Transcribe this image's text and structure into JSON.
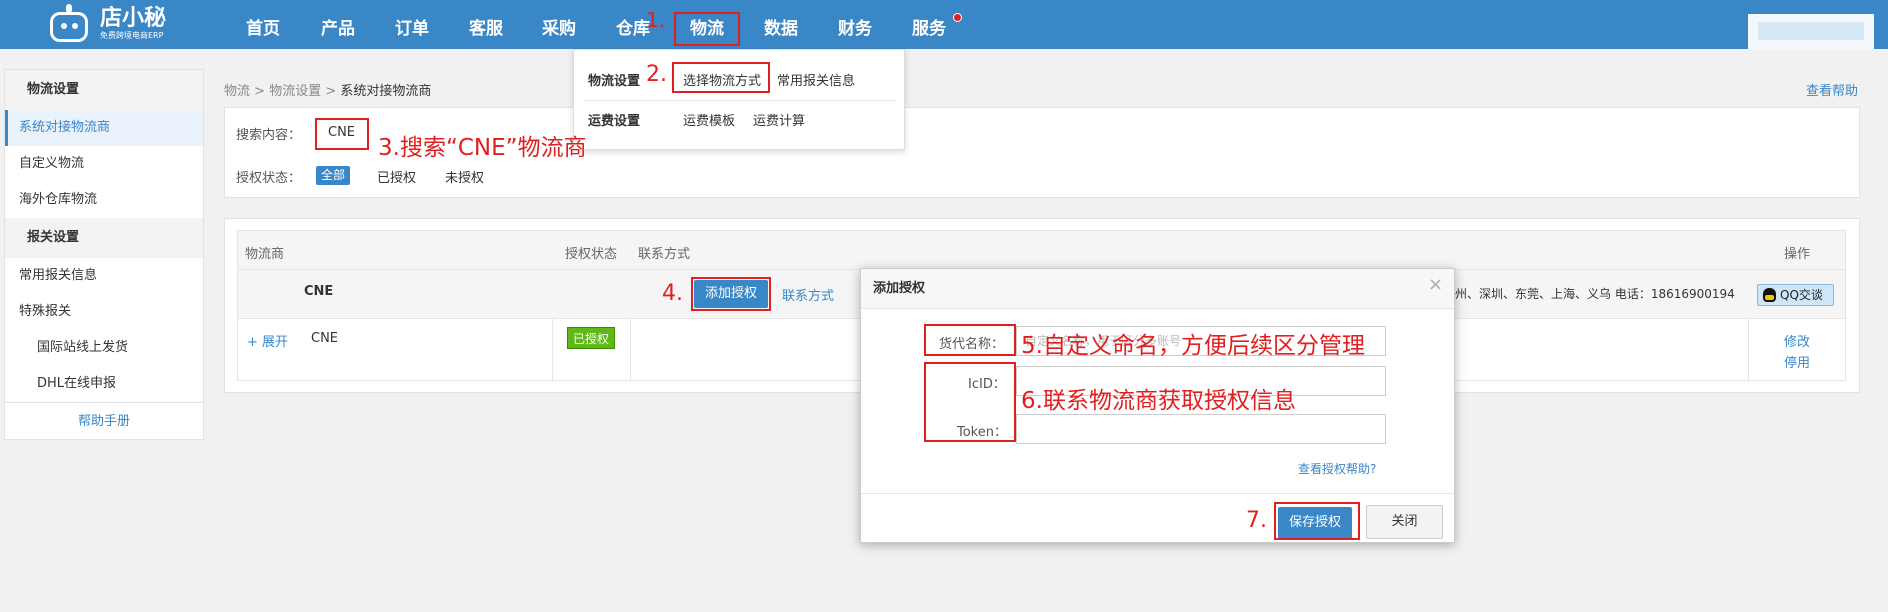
{
  "app": {
    "logo_text": "店小秘",
    "logo_sub": "免费跨境电商ERP"
  },
  "nav": [
    "首页",
    "产品",
    "订单",
    "客服",
    "采购",
    "仓库",
    "物流",
    "数据",
    "财务",
    "服务"
  ],
  "dropdown": {
    "group1_title": "物流设置",
    "group1_items": [
      "选择物流方式",
      "常用报关信息"
    ],
    "group2_title": "运费设置",
    "group2_items": [
      "运费模板",
      "运费计算"
    ]
  },
  "sidebar": {
    "section1": "物流设置",
    "items1": [
      "系统对接物流商",
      "自定义物流",
      "海外仓库物流"
    ],
    "section2": "报关设置",
    "items2": [
      "常用报关信息",
      "特殊报关"
    ],
    "sub_items": [
      "国际站线上发货",
      "DHL在线申报"
    ],
    "help": "帮助手册"
  },
  "breadcrumb": {
    "a": "物流",
    "sep": " > ",
    "b": "物流设置",
    "c": "系统对接物流商"
  },
  "help_link": "查看帮助",
  "search": {
    "label": "搜索内容：",
    "value": "CNE",
    "status_label": "授权状态：",
    "tabs": [
      "全部",
      "已授权",
      "未授权"
    ]
  },
  "table": {
    "headers": [
      "物流商",
      "授权状态",
      "联系方式",
      "操作"
    ],
    "group_name": "CNE",
    "add_auth": "添加授权",
    "contact_link": "联系方式",
    "contact_text": "州、深圳、东莞、上海、义乌  电话：18616900194",
    "qq": "QQ交谈",
    "row": {
      "expand": "+ 展开",
      "name": "CNE",
      "status": "已授权",
      "ops": [
        "修改",
        "停用"
      ]
    }
  },
  "modal": {
    "title": "添加授权",
    "close": "×",
    "fields": [
      {
        "label": "货代名称：",
        "placeholder": "自定义名称，用于区分多账号"
      },
      {
        "label": "IcID：",
        "placeholder": ""
      },
      {
        "label": "Token：",
        "placeholder": ""
      }
    ],
    "help_link": "查看授权帮助?",
    "save": "保存授权",
    "cancel": "关闭"
  },
  "annotations": [
    "1.",
    "2.",
    "3.搜索“CNE”物流商",
    "4.",
    "5.自定义命名，方便后续区分管理",
    "6.联系物流商获取授权信息",
    "7."
  ],
  "colors": {
    "primary": "#3a87c8",
    "annotation": "#e02020",
    "authorized": "#5fb914"
  }
}
